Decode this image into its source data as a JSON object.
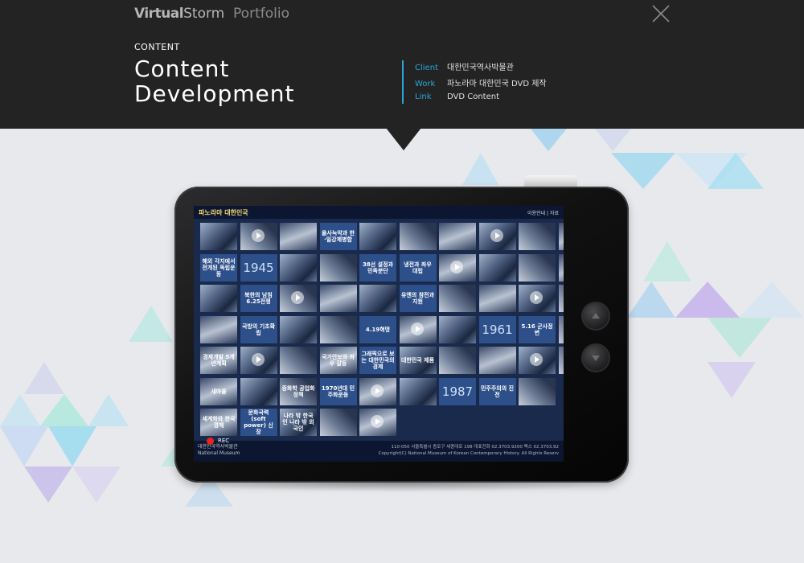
{
  "header": {
    "brand_bold": "Virtual",
    "brand_rest": "Storm",
    "brand_section": "Portfolio",
    "category": "CONTENT",
    "title_line1": "Content",
    "title_line2": "Development",
    "info": [
      {
        "key": "Client",
        "value": "대한민국역사박물관"
      },
      {
        "key": "Work",
        "value": "파노라마 대한민국 DVD 제작"
      },
      {
        "key": "Link",
        "value": "DVD Content"
      }
    ],
    "close_icon": "close-icon"
  },
  "colors": {
    "header_bg": "#232323",
    "accent": "#2aa6d8",
    "background": "#e8e9ec"
  },
  "screen": {
    "title": "파노라마 대한민국",
    "menu": "이용안내 | 자료",
    "tiles": [
      {
        "label": "",
        "kind": "photo",
        "play": false
      },
      {
        "label": "",
        "kind": "photo2",
        "play": true
      },
      {
        "label": "",
        "kind": "photo3",
        "play": false
      },
      {
        "label": "을사늑약과 한·일강제병합",
        "kind": "text",
        "play": false
      },
      {
        "label": "",
        "kind": "photo",
        "play": false
      },
      {
        "label": "",
        "kind": "photo2",
        "play": false
      },
      {
        "label": "",
        "kind": "photo3",
        "play": false
      },
      {
        "label": "",
        "kind": "photo",
        "play": true
      },
      {
        "label": "",
        "kind": "photo2",
        "play": false
      },
      {
        "label": "",
        "kind": "photo3",
        "play": false
      },
      {
        "label": "해외 각지에서 전개된 독립운동",
        "kind": "text",
        "play": false
      },
      {
        "label": "1945",
        "kind": "text",
        "big": true,
        "play": false
      },
      {
        "label": "",
        "kind": "photo",
        "play": false
      },
      {
        "label": "",
        "kind": "photo2",
        "play": false
      },
      {
        "label": "38선 설정과 민족분단",
        "kind": "text",
        "play": false
      },
      {
        "label": "냉전과 좌우 대립",
        "kind": "text",
        "play": false
      },
      {
        "label": "",
        "kind": "photo3",
        "play": true
      },
      {
        "label": "",
        "kind": "photo",
        "play": false
      },
      {
        "label": "",
        "kind": "photo2",
        "play": false
      },
      {
        "label": "",
        "kind": "photo3",
        "play": false
      },
      {
        "label": "",
        "kind": "photo",
        "play": false
      },
      {
        "label": "북한의 남침 6.25전쟁",
        "kind": "text",
        "play": false
      },
      {
        "label": "",
        "kind": "photo2",
        "play": true
      },
      {
        "label": "",
        "kind": "photo3",
        "play": false
      },
      {
        "label": "",
        "kind": "photo",
        "play": false
      },
      {
        "label": "유엔의 참전과 지원",
        "kind": "text",
        "play": false
      },
      {
        "label": "",
        "kind": "photo2",
        "play": false
      },
      {
        "label": "",
        "kind": "photo3",
        "play": false
      },
      {
        "label": "",
        "kind": "photo",
        "play": true
      },
      {
        "label": "",
        "kind": "photo2",
        "play": false
      },
      {
        "label": "",
        "kind": "photo3",
        "play": false
      },
      {
        "label": "국방의 기초확립",
        "kind": "text",
        "play": false
      },
      {
        "label": "",
        "kind": "photo",
        "play": false
      },
      {
        "label": "",
        "kind": "photo2",
        "play": false
      },
      {
        "label": "4.19혁명",
        "kind": "text",
        "play": false
      },
      {
        "label": "",
        "kind": "photo3",
        "play": true
      },
      {
        "label": "",
        "kind": "photo",
        "play": false
      },
      {
        "label": "1961",
        "kind": "text",
        "big": true,
        "play": false
      },
      {
        "label": "5.16 군사정변",
        "kind": "text",
        "play": false
      },
      {
        "label": "",
        "kind": "photo2",
        "play": false
      },
      {
        "label": "경제개발 5개년계획",
        "kind": "photo3",
        "play": false
      },
      {
        "label": "",
        "kind": "photo",
        "play": true
      },
      {
        "label": "",
        "kind": "photo2",
        "play": false
      },
      {
        "label": "국가안보와 좌우 갈등",
        "kind": "photo3",
        "play": false
      },
      {
        "label": "그래픽으로 보는 대한민국의 경제",
        "kind": "text",
        "play": false
      },
      {
        "label": "대한민국 제품",
        "kind": "photo",
        "play": false
      },
      {
        "label": "",
        "kind": "photo2",
        "play": false
      },
      {
        "label": "",
        "kind": "photo3",
        "play": false
      },
      {
        "label": "",
        "kind": "photo",
        "play": true
      },
      {
        "label": "",
        "kind": "photo2",
        "play": false
      },
      {
        "label": "새마을",
        "kind": "photo3",
        "play": false
      },
      {
        "label": "",
        "kind": "photo",
        "play": false
      },
      {
        "label": "중화학 공업화 정책",
        "kind": "photo2",
        "play": false
      },
      {
        "label": "1970년대 민주화운동",
        "kind": "text",
        "play": false
      },
      {
        "label": "",
        "kind": "photo3",
        "play": true
      },
      {
        "label": "",
        "kind": "photo",
        "play": false
      },
      {
        "label": "1987",
        "kind": "text",
        "big": true,
        "play": false
      },
      {
        "label": "민주주의의 진전",
        "kind": "text",
        "play": false
      },
      {
        "label": "",
        "kind": "photo2",
        "play": false
      },
      {
        "label": "",
        "kind": "empty",
        "play": false
      },
      {
        "label": "세계화와 한국경제",
        "kind": "photo3",
        "play": false
      },
      {
        "label": "문화국력 (soft power) 신장",
        "kind": "text",
        "play": false
      },
      {
        "label": "나라 밖 한국인 나라 밖 외국인",
        "kind": "photo",
        "play": false
      },
      {
        "label": "",
        "kind": "photo2",
        "play": false
      },
      {
        "label": "",
        "kind": "photo3",
        "play": true
      }
    ],
    "rec_label": "REC",
    "logo_line1": "대한민국역사박물관",
    "logo_line2": "National Museum",
    "addr_line1": "110-050 서울특별시 종로구 세종대로 198   대표전화 02.3703.9200   팩스 02.3703.92",
    "addr_line2": "Copyright(C) National Museum of Korean Contemporary History. All Rights Reserv"
  }
}
